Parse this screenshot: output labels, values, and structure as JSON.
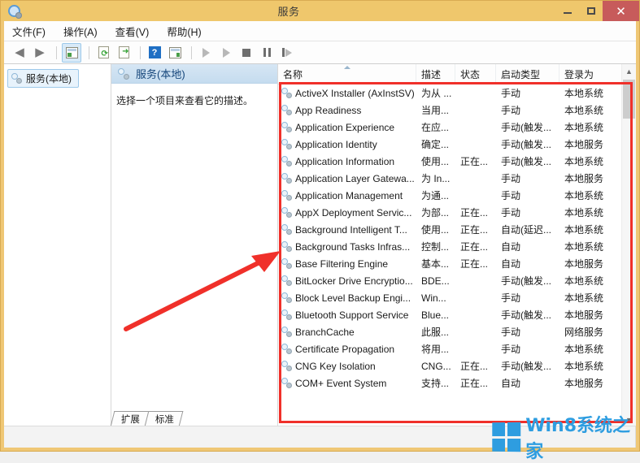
{
  "window": {
    "title": "服务",
    "icon": "services-icon",
    "controls": {
      "minimize": "–",
      "maximize": "□",
      "close": "✕"
    }
  },
  "menubar": {
    "items": [
      {
        "label": "文件(F)",
        "name": "menu-file"
      },
      {
        "label": "操作(A)",
        "name": "menu-action"
      },
      {
        "label": "查看(V)",
        "name": "menu-view"
      },
      {
        "label": "帮助(H)",
        "name": "menu-help"
      }
    ]
  },
  "toolbar": {
    "buttons": [
      "back-icon",
      "forward-icon",
      "show-hide-console-tree-icon",
      "refresh-icon",
      "export-list-icon",
      "help-icon",
      "properties-icon",
      "start-service-icon",
      "resume-service-icon",
      "stop-service-icon",
      "pause-service-icon",
      "restart-service-icon"
    ]
  },
  "tree": {
    "root_label": "服务(本地)"
  },
  "detail": {
    "title": "服务(本地)",
    "description": "选择一个项目来查看它的描述。"
  },
  "list": {
    "columns": [
      {
        "key": "name",
        "label": "名称",
        "sorted": true
      },
      {
        "key": "desc",
        "label": "描述"
      },
      {
        "key": "state",
        "label": "状态"
      },
      {
        "key": "start",
        "label": "启动类型"
      },
      {
        "key": "logon",
        "label": "登录为"
      }
    ],
    "rows": [
      {
        "name": "ActiveX Installer (AxInstSV)",
        "desc": "为从 ...",
        "state": "",
        "start": "手动",
        "logon": "本地系统"
      },
      {
        "name": "App Readiness",
        "desc": "当用...",
        "state": "",
        "start": "手动",
        "logon": "本地系统"
      },
      {
        "name": "Application Experience",
        "desc": "在应...",
        "state": "",
        "start": "手动(触发...",
        "logon": "本地系统"
      },
      {
        "name": "Application Identity",
        "desc": "确定...",
        "state": "",
        "start": "手动(触发...",
        "logon": "本地服务"
      },
      {
        "name": "Application Information",
        "desc": "使用...",
        "state": "正在...",
        "start": "手动(触发...",
        "logon": "本地系统"
      },
      {
        "name": "Application Layer Gatewa...",
        "desc": "为 In...",
        "state": "",
        "start": "手动",
        "logon": "本地服务"
      },
      {
        "name": "Application Management",
        "desc": "为通...",
        "state": "",
        "start": "手动",
        "logon": "本地系统"
      },
      {
        "name": "AppX Deployment Servic...",
        "desc": "为部...",
        "state": "正在...",
        "start": "手动",
        "logon": "本地系统"
      },
      {
        "name": "Background Intelligent T...",
        "desc": "使用...",
        "state": "正在...",
        "start": "自动(延迟...",
        "logon": "本地系统"
      },
      {
        "name": "Background Tasks Infras...",
        "desc": "控制...",
        "state": "正在...",
        "start": "自动",
        "logon": "本地系统"
      },
      {
        "name": "Base Filtering Engine",
        "desc": "基本...",
        "state": "正在...",
        "start": "自动",
        "logon": "本地服务"
      },
      {
        "name": "BitLocker Drive Encryptio...",
        "desc": "BDE...",
        "state": "",
        "start": "手动(触发...",
        "logon": "本地系统"
      },
      {
        "name": "Block Level Backup Engi...",
        "desc": "Win...",
        "state": "",
        "start": "手动",
        "logon": "本地系统"
      },
      {
        "name": "Bluetooth Support Service",
        "desc": "Blue...",
        "state": "",
        "start": "手动(触发...",
        "logon": "本地服务"
      },
      {
        "name": "BranchCache",
        "desc": "此服...",
        "state": "",
        "start": "手动",
        "logon": "网络服务"
      },
      {
        "name": "Certificate Propagation",
        "desc": "将用...",
        "state": "",
        "start": "手动",
        "logon": "本地系统"
      },
      {
        "name": "CNG Key Isolation",
        "desc": "CNG...",
        "state": "正在...",
        "start": "手动(触发...",
        "logon": "本地系统"
      },
      {
        "name": "COM+ Event System",
        "desc": "支持...",
        "state": "正在...",
        "start": "自动",
        "logon": "本地服务"
      }
    ]
  },
  "tabs": [
    {
      "label": "扩展",
      "name": "tab-extended",
      "active": false
    },
    {
      "label": "标准",
      "name": "tab-standard",
      "active": true
    }
  ],
  "watermark": {
    "text": "Win8系统之家"
  },
  "colors": {
    "titlebar": "#efc76c",
    "close_button": "#c75b5b",
    "annotation_red": "#f0302a",
    "watermark_blue": "#2e9de0",
    "detail_header": "#c5dcef"
  }
}
